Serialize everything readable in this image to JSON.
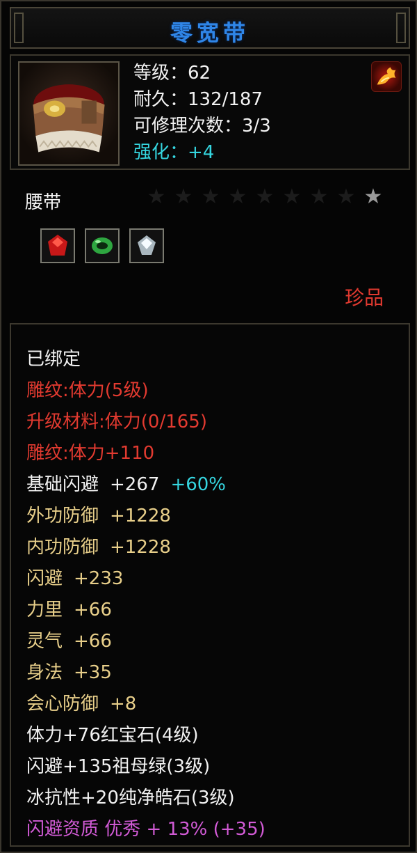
{
  "item": {
    "name": "零宽带",
    "level": "等级：62",
    "durability": "耐久：132/187",
    "repairs": "可修理次数：3/3",
    "enhance": "强化：+4",
    "type": "腰带",
    "rarity": "珍品",
    "stars_total": 9,
    "stars_lit": 1
  },
  "gems": [
    {
      "name": "ruby-gem-icon",
      "color": "#c81818"
    },
    {
      "name": "emerald-gem-icon",
      "color": "#2ea640"
    },
    {
      "name": "diamond-gem-icon",
      "color": "#d8e4ea"
    }
  ],
  "attributes": {
    "bound": "已绑定",
    "engrave_level": "雕纹:体力(5级)",
    "upgrade_material": "升级材料:体力(0/165)",
    "engrave_bonus": "雕纹:体力+110",
    "base_dodge": {
      "label": "基础闪避",
      "value": "+267",
      "extra": "+60%"
    },
    "lines_gold": [
      {
        "label": "外功防御",
        "value": "+1228"
      },
      {
        "label": "内功防御",
        "value": "+1228"
      },
      {
        "label": "闪避",
        "value": "+233"
      },
      {
        "label": "力里",
        "value": "+66"
      },
      {
        "label": "灵气",
        "value": "+66"
      },
      {
        "label": "身法",
        "value": "+35"
      },
      {
        "label": "会心防御",
        "value": "+8"
      }
    ],
    "gem_stats": [
      "体力+76红宝石(4级)",
      "闪避+135祖母绿(3级)",
      "冰抗性+20纯净皓石(3级)"
    ],
    "aptitude": "闪避资质  优秀  + 13% (+35)"
  },
  "colors": {
    "title": "#2f86e8",
    "red": "#e23a30",
    "gold": "#e8cf8a",
    "cyan": "#35d6e0",
    "pink": "#d25bd6"
  }
}
